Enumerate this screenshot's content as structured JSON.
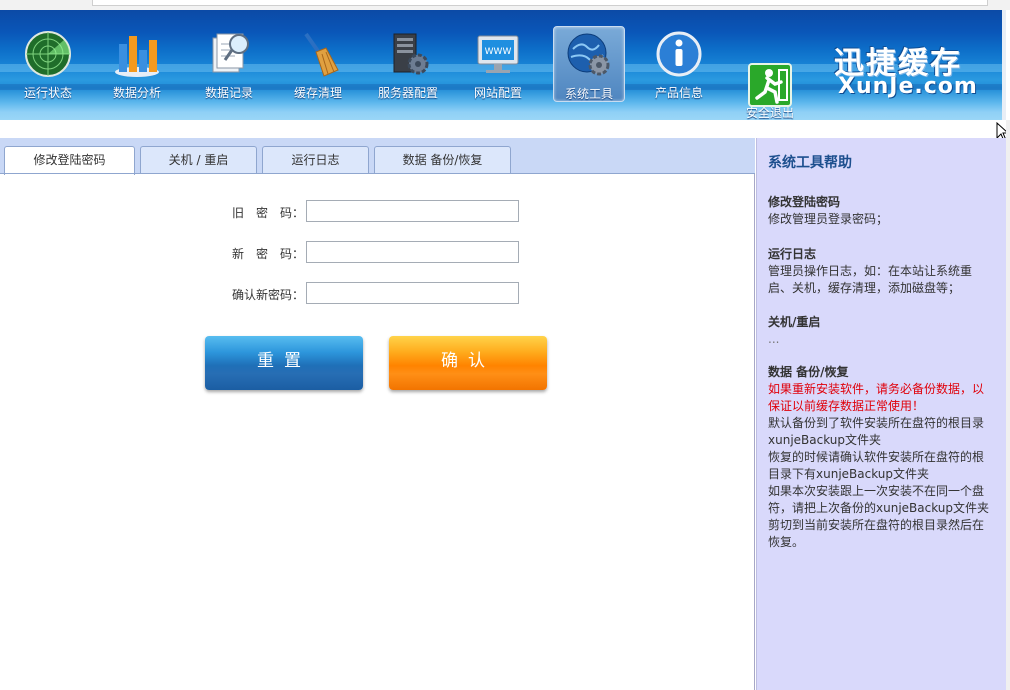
{
  "nav": {
    "items": [
      {
        "label": "运行状态",
        "icon": "radar-icon"
      },
      {
        "label": "数据分析",
        "icon": "bar-chart-icon"
      },
      {
        "label": "数据记录",
        "icon": "file-search-icon"
      },
      {
        "label": "缓存清理",
        "icon": "broom-icon"
      },
      {
        "label": "服务器配置",
        "icon": "server-gear-icon"
      },
      {
        "label": "网站配置",
        "icon": "monitor-www-icon"
      },
      {
        "label": "系统工具",
        "icon": "globe-gear-icon"
      },
      {
        "label": "产品信息",
        "icon": "info-icon"
      }
    ],
    "active_index": 6,
    "exit_label": "安全退出",
    "exit_icon": "exit-door-icon"
  },
  "logo": {
    "cn": "迅捷缓存",
    "en": "XunJe.com"
  },
  "tabs": [
    {
      "label": "修改登陆密码",
      "active": true
    },
    {
      "label": "关机 / 重启",
      "active": false
    },
    {
      "label": "运行日志",
      "active": false
    },
    {
      "label": "数据 备份/恢复",
      "active": false
    }
  ],
  "form": {
    "old_password_label": "旧　密　码：",
    "new_password_label": "新　密　码：",
    "confirm_password_label": "确认新密码：",
    "old_password_value": "",
    "new_password_value": "",
    "confirm_password_value": "",
    "reset_label": "重置",
    "confirm_label": "确认"
  },
  "help": {
    "title": "系统工具帮助",
    "sections": [
      {
        "title": "修改登陆密码",
        "text": "修改管理员登录密码；"
      },
      {
        "title": "运行日志",
        "text": "管理员操作日志，如：在本站让系统重启、关机，缓存清理，添加磁盘等；"
      },
      {
        "title": "关机/重启",
        "text": "..."
      },
      {
        "title": "数据 备份/恢复",
        "warning": "如果重新安装软件，请务必备份数据，以保证以前缓存数据正常使用！",
        "text": "默认备份到了软件安装所在盘符的根目录xunjeBackup文件夹\n恢复的时候请确认软件安装所在盘符的根目录下有xunjeBackup文件夹\n如果本次安装跟上一次安装不在同一个盘符，请把上次备份的xunjeBackup文件夹剪切到当前安装所在盘符的根目录然后在恢复。"
      }
    ]
  },
  "colors": {
    "header_blue": "#0a56b8",
    "help_bg": "#d9d9fb",
    "help_title": "#1d4f8e",
    "warning_red": "#e0000a",
    "reset_button": "#1f6fb7",
    "confirm_button": "#ff8300"
  }
}
